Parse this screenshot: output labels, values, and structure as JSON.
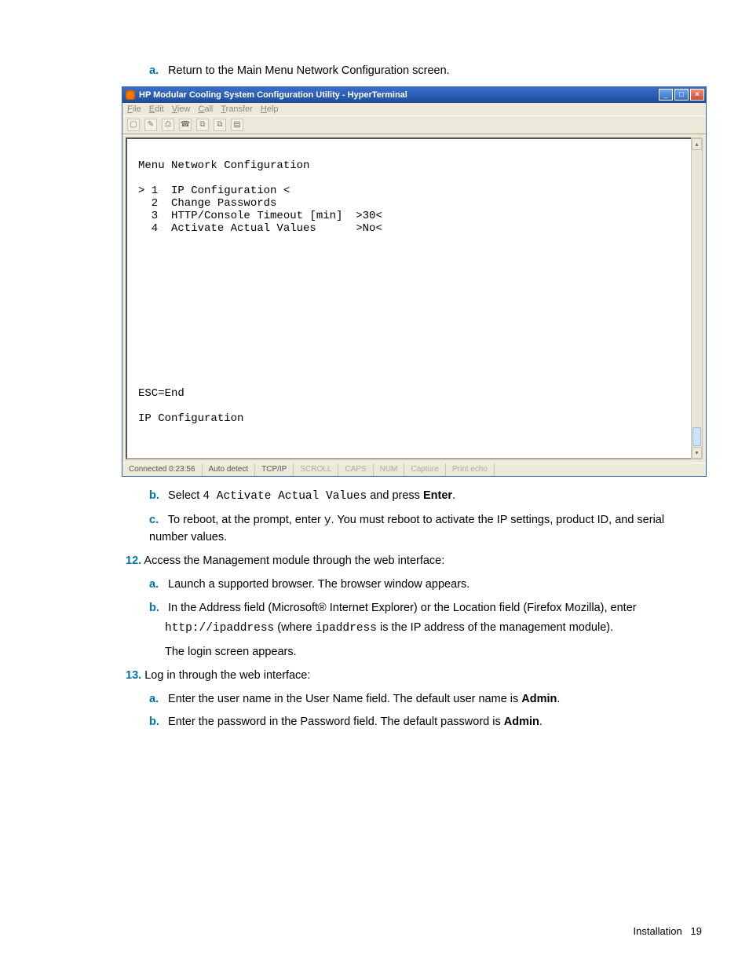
{
  "pre_step": {
    "marker": "a.",
    "text": "Return to the Main Menu Network Configuration screen."
  },
  "ht": {
    "title": "HP Modular Cooling System Configuration Utility - HyperTerminal",
    "menu": [
      "File",
      "Edit",
      "View",
      "Call",
      "Transfer",
      "Help"
    ],
    "term_lines": "\nMenu Network Configuration\n\n> 1  IP Configuration <\n  2  Change Passwords\n  3  HTTP/Console Timeout [min]  >30<\n  4  Activate Actual Values      >No<\n\n\n\n\n\n\n\n\n\n\n\n\nESC=End\n\nIP Configuration",
    "status": {
      "conn": "Connected 0:23:56",
      "detect": "Auto detect",
      "proto": "TCP/IP",
      "flags": [
        "SCROLL",
        "CAPS",
        "NUM",
        "Capture",
        "Print echo"
      ]
    }
  },
  "steps_after": {
    "b": {
      "marker": "b.",
      "pre": "Select ",
      "mono": "4 Activate Actual Values",
      "mid": " and press ",
      "bold": "Enter",
      "post": "."
    },
    "c": {
      "marker": "c.",
      "pre": "To reboot, at the prompt, enter ",
      "mono": "y",
      "post": ". You must reboot to activate the IP settings, product ID, and serial number values."
    }
  },
  "step12": {
    "marker": "12.",
    "text": "Access the Management module through the web interface:",
    "a": {
      "marker": "a.",
      "text": "Launch a supported browser. The browser window appears."
    },
    "b": {
      "marker": "b.",
      "line1_pre": "In the Address field (Microsoft® Internet Explorer) or the Location field (Firefox Mozilla), enter ",
      "line2_mono1": "http://ipaddress",
      "line2_mid": " (where ",
      "line2_mono2": "ipaddress",
      "line2_post": " is the IP address of the management module).",
      "line3": "The login screen appears."
    }
  },
  "step13": {
    "marker": "13.",
    "text": "Log in through the web interface:",
    "a": {
      "marker": "a.",
      "pre": "Enter the user name in the User Name field. The default user name is ",
      "bold": "Admin",
      "post": "."
    },
    "b": {
      "marker": "b.",
      "pre": "Enter the password in the Password field. The default password is ",
      "bold": "Admin",
      "post": "."
    }
  },
  "footer": {
    "section": "Installation",
    "page": "19"
  }
}
